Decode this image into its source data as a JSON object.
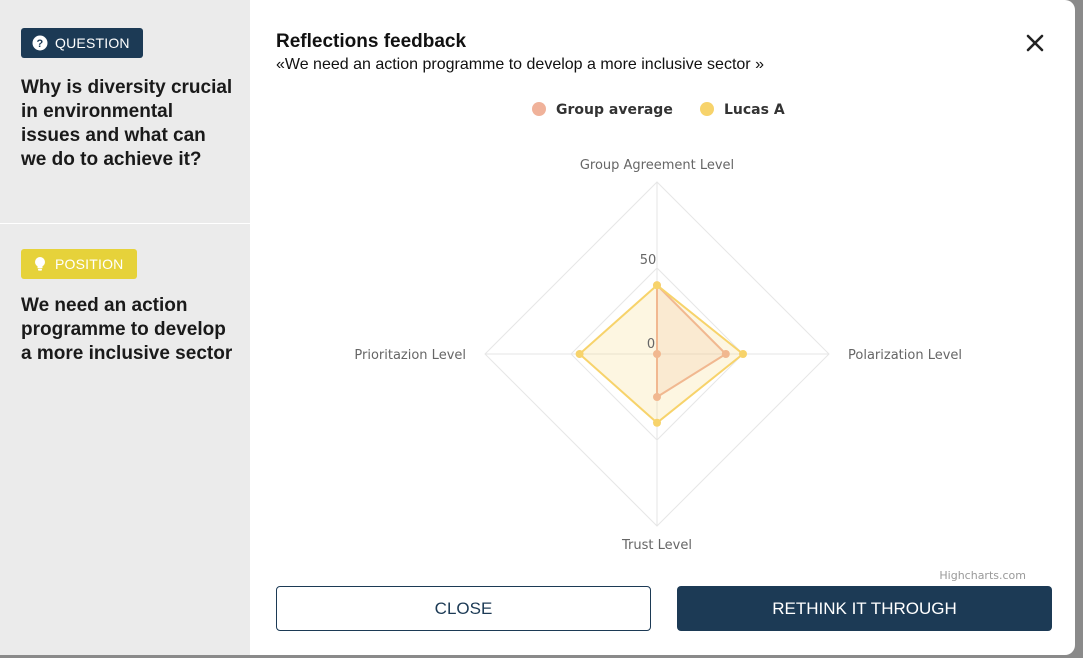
{
  "sidebar": {
    "question_badge": "QUESTION",
    "question_text": "Why is diversity crucial in environmental issues and what can we do to achieve it?",
    "position_badge": "POSITION",
    "position_text": "We need an action programme to develop a more inclusive sector"
  },
  "header": {
    "title": "Reflections feedback",
    "subtitle": "«We need an action programme to develop a more inclusive sector »",
    "close_icon": "close-icon"
  },
  "colors": {
    "navy": "#1c3a55",
    "yellow": "#e6d23a",
    "group_average": "#f0b29a",
    "lucas": "#f7d36b"
  },
  "chart_data": {
    "type": "radar",
    "categories": [
      "Group Agreement Level",
      "Polarization Level",
      "Trust Level",
      "Prioritazion Level"
    ],
    "axis_labels": [
      "0",
      "50"
    ],
    "ylim": [
      0,
      100
    ],
    "series": [
      {
        "name": "Group average",
        "values": [
          40,
          40,
          25,
          0
        ]
      },
      {
        "name": "Lucas A",
        "values": [
          40,
          50,
          40,
          45
        ]
      }
    ],
    "legend": "top",
    "credits": "Highcharts.com"
  },
  "buttons": {
    "close_label": "CLOSE",
    "rethink_label": "RETHINK IT THROUGH"
  }
}
